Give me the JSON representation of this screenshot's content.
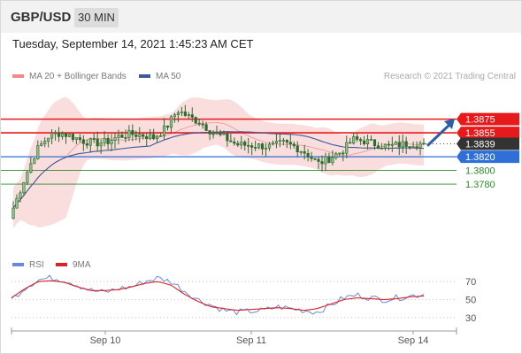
{
  "header": {
    "symbol": "GBP/USD",
    "timeframe": "30 MIN"
  },
  "timestamp": "Tuesday, September 14, 2021 1:45:23 AM CET",
  "credit": "Research © 2021 Trading Central",
  "legend": {
    "bollinger": "MA 20 + Bollinger Bands",
    "ma50": "MA 50",
    "rsi": "RSI",
    "rsi_ma": "9MA"
  },
  "colors": {
    "resistance": "#e8191a",
    "support": "#2e6fd9",
    "target": "#2a8a2a",
    "current": "#333333",
    "ma50": "#3d5a99",
    "bands": "#f4b8b8",
    "candle": "#2f6b2f",
    "rsi": "#6688dd",
    "rsi_ma": "#dd2222",
    "arrow": "#2d5fa6"
  },
  "chart_data": [
    {
      "type": "candlestick",
      "x_ticks": [
        "Sep 10",
        "Sep 11",
        "Sep 14"
      ],
      "y_range": [
        1.3705,
        1.3925
      ],
      "levels": [
        {
          "value": "1.3875",
          "role": "resistance"
        },
        {
          "value": "1.3855",
          "role": "resistance"
        },
        {
          "value": "1.3839",
          "role": "current"
        },
        {
          "value": "1.3820",
          "role": "support"
        },
        {
          "value": "1.3800",
          "role": "target"
        },
        {
          "value": "1.3780",
          "role": "target"
        }
      ],
      "series": [
        {
          "name": "MA 20 + Bollinger Bands"
        },
        {
          "name": "MA 50"
        }
      ],
      "price_path": [
        1.3745,
        1.379,
        1.383,
        1.385,
        1.3855,
        1.385,
        1.3843,
        1.384,
        1.3842,
        1.385,
        1.3853,
        1.3852,
        1.3848,
        1.3862,
        1.3888,
        1.3878,
        1.387,
        1.3855,
        1.3848,
        1.3838,
        1.3837,
        1.3836,
        1.3835,
        1.384,
        1.3835,
        1.3825,
        1.381,
        1.3818,
        1.3828,
        1.3845,
        1.3843,
        1.3838,
        1.3835,
        1.3838,
        1.384,
        1.3839
      ]
    },
    {
      "type": "line",
      "title": "RSI",
      "y_ticks": [
        30,
        50,
        70
      ],
      "y_range": [
        20,
        80
      ],
      "rsi_path": [
        50,
        63,
        72,
        74,
        72,
        66,
        60,
        58,
        62,
        64,
        70,
        74,
        70,
        60,
        50,
        44,
        38,
        36,
        37,
        38,
        42,
        40,
        38,
        36,
        44,
        52,
        55,
        52,
        50,
        52,
        54,
        56
      ],
      "rsi_ma_path": [
        52,
        62,
        70,
        71,
        69,
        64,
        60,
        60,
        61,
        64,
        68,
        70,
        66,
        56,
        48,
        42,
        40,
        38,
        39,
        40,
        41,
        40,
        38,
        40,
        45,
        50,
        52,
        51,
        50,
        51,
        53,
        54
      ]
    }
  ]
}
